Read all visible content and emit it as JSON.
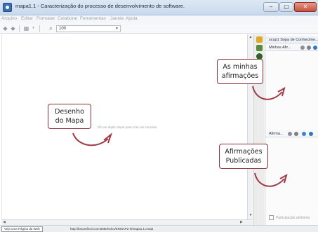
{
  "window": {
    "title": "mapa1.1 - Caracterização do processo de desenvolvimento de software."
  },
  "window_controls": {
    "minimize": "–",
    "maximize": "▢",
    "close": "✕"
  },
  "menu": [
    "Arquivo",
    "Editar",
    "Formatar",
    "Colaborar",
    "Ferramentas",
    "Janela",
    "Ajuda"
  ],
  "toolbar": {
    "zoom_value": "100",
    "dropdown_arrow": "▼"
  },
  "canvas": {
    "hint": "Dê um duplo clique para criar um conceito"
  },
  "right_panel": {
    "header1": "scup1 Sopa de Conhecime...",
    "header2": "Minhas Afir...",
    "header3": "Afirma...",
    "checkbox_label": "Participação anônima"
  },
  "status": {
    "button": "Veja uma Página da Web",
    "url": "http://bsoonfecti.com:8080/vdv1/ERMAP2-0/mapa1.1.cmap"
  },
  "annotations": {
    "desenho": [
      "Desenho",
      "do Mapa"
    ],
    "minhas": [
      "As minhas",
      "afirmações"
    ],
    "publicadas": [
      "Afirmações",
      "Publicadas"
    ]
  },
  "colors": {
    "annotation_border": "#8b2f3a",
    "annotation_arrow": "#9e3a45",
    "titlebar": "#c9d9ec"
  }
}
